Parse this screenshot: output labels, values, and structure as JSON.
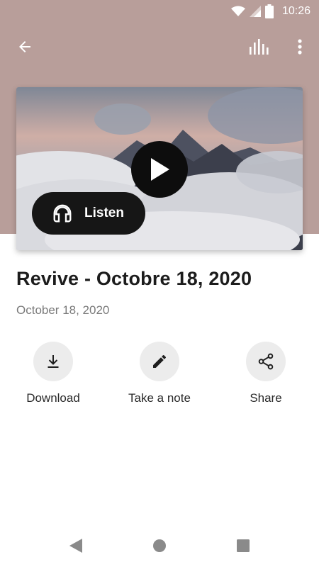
{
  "status_bar": {
    "time": "10:26"
  },
  "colors": {
    "header_background": "#b89e9a",
    "accent_dark": "#161616"
  },
  "app_bar": {
    "back_icon": "arrow-left-icon",
    "equalizer_icon": "equalizer-icon",
    "more_icon": "more-vert-icon"
  },
  "hero": {
    "image": "mountain-peaks-in-clouds",
    "play_icon": "play-icon",
    "listen_icon": "headphones-icon",
    "listen_label": "Listen"
  },
  "episode": {
    "title": "Revive - Octobre 18, 2020",
    "date": "October 18, 2020"
  },
  "actions": [
    {
      "icon": "download-icon",
      "label": "Download"
    },
    {
      "icon": "pencil-icon",
      "label": "Take a note"
    },
    {
      "icon": "share-icon",
      "label": "Share"
    }
  ],
  "nav_bar": {
    "back": "triangle-back-icon",
    "home": "circle-home-icon",
    "recents": "square-recents-icon"
  }
}
